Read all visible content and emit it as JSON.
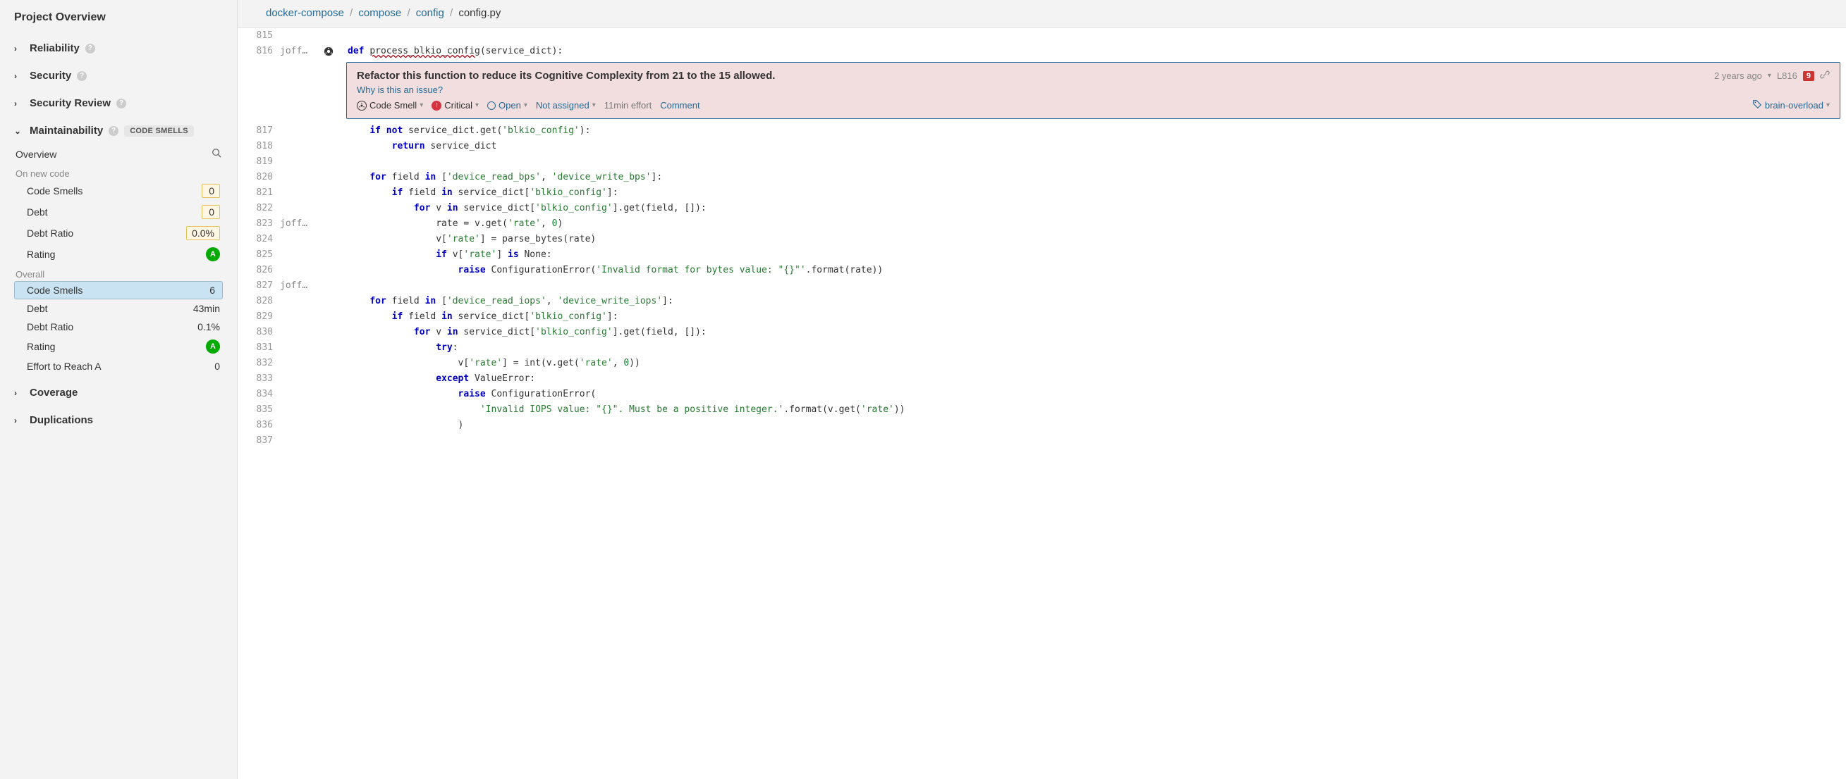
{
  "sidebar": {
    "title": "Project Overview",
    "sections": [
      {
        "label": "Reliability",
        "expanded": false,
        "help": true
      },
      {
        "label": "Security",
        "expanded": false,
        "help": true
      },
      {
        "label": "Security Review",
        "expanded": false,
        "help": true
      },
      {
        "label": "Maintainability",
        "expanded": true,
        "help": true,
        "badge": "CODE SMELLS"
      },
      {
        "label": "Coverage",
        "expanded": false
      },
      {
        "label": "Duplications",
        "expanded": false
      }
    ],
    "overview_label": "Overview",
    "new_code_label": "On new code",
    "overall_label": "Overall",
    "new_code": [
      {
        "label": "Code Smells",
        "value": "0",
        "boxed": true
      },
      {
        "label": "Debt",
        "value": "0",
        "boxed": true
      },
      {
        "label": "Debt Ratio",
        "value": "0.0%",
        "boxed": true
      },
      {
        "label": "Rating",
        "value": "A",
        "rating": true
      }
    ],
    "overall": [
      {
        "label": "Code Smells",
        "value": "6",
        "selected": true
      },
      {
        "label": "Debt",
        "value": "43min"
      },
      {
        "label": "Debt Ratio",
        "value": "0.1%"
      },
      {
        "label": "Rating",
        "value": "A",
        "rating": true
      },
      {
        "label": "Effort to Reach A",
        "value": "0"
      }
    ]
  },
  "breadcrumb": {
    "parts": [
      "docker-compose",
      "compose",
      "config"
    ],
    "current": "config.py"
  },
  "issue": {
    "title": "Refactor this function to reduce its Cognitive Complexity from 21 to the 15 allowed.",
    "age": "2 years ago",
    "line": "L816",
    "count": "9",
    "why": "Why is this an issue?",
    "type": "Code Smell",
    "severity": "Critical",
    "status": "Open",
    "assignee": "Not assigned",
    "effort": "11min effort",
    "comment": "Comment",
    "tag": "brain-overload"
  },
  "code": {
    "lines": [
      {
        "n": "815",
        "author": "",
        "bar": false,
        "text": ""
      },
      {
        "n": "816",
        "author": "joff…",
        "bar": true,
        "icon": true,
        "parts": [
          {
            "t": "def ",
            "c": "kw"
          },
          {
            "t": "process_blkio_config",
            "c": "fn-name underline-issue"
          },
          {
            "t": "(service_dict):"
          }
        ]
      },
      {
        "n": "817",
        "author": "",
        "bar": true,
        "parts": [
          {
            "t": "    "
          },
          {
            "t": "if not",
            "c": "kw"
          },
          {
            "t": " service_dict.get("
          },
          {
            "t": "'blkio_config'",
            "c": "str"
          },
          {
            "t": "):"
          }
        ]
      },
      {
        "n": "818",
        "author": "",
        "bar": true,
        "parts": [
          {
            "t": "        "
          },
          {
            "t": "return",
            "c": "kw"
          },
          {
            "t": " service_dict"
          }
        ]
      },
      {
        "n": "819",
        "author": "",
        "bar": false,
        "text": ""
      },
      {
        "n": "820",
        "author": "",
        "bar": true,
        "parts": [
          {
            "t": "    "
          },
          {
            "t": "for",
            "c": "kw"
          },
          {
            "t": " field "
          },
          {
            "t": "in",
            "c": "kw"
          },
          {
            "t": " ["
          },
          {
            "t": "'device_read_bps'",
            "c": "str"
          },
          {
            "t": ", "
          },
          {
            "t": "'device_write_bps'",
            "c": "str"
          },
          {
            "t": "]:"
          }
        ]
      },
      {
        "n": "821",
        "author": "",
        "bar": true,
        "parts": [
          {
            "t": "        "
          },
          {
            "t": "if",
            "c": "kw"
          },
          {
            "t": " field "
          },
          {
            "t": "in",
            "c": "kw"
          },
          {
            "t": " service_dict["
          },
          {
            "t": "'blkio_config'",
            "c": "str"
          },
          {
            "t": "]:"
          }
        ]
      },
      {
        "n": "822",
        "author": "",
        "bar": true,
        "parts": [
          {
            "t": "            "
          },
          {
            "t": "for",
            "c": "kw"
          },
          {
            "t": " v "
          },
          {
            "t": "in",
            "c": "kw"
          },
          {
            "t": " service_dict["
          },
          {
            "t": "'blkio_config'",
            "c": "str"
          },
          {
            "t": "].get(field, []):"
          }
        ]
      },
      {
        "n": "823",
        "author": "joff…",
        "bar": true,
        "parts": [
          {
            "t": "                rate = v.get("
          },
          {
            "t": "'rate'",
            "c": "str"
          },
          {
            "t": ", "
          },
          {
            "t": "0",
            "c": "num"
          },
          {
            "t": ")"
          }
        ]
      },
      {
        "n": "824",
        "author": "",
        "bar": true,
        "parts": [
          {
            "t": "                v["
          },
          {
            "t": "'rate'",
            "c": "str"
          },
          {
            "t": "] = parse_bytes(rate)"
          }
        ]
      },
      {
        "n": "825",
        "author": "",
        "bar": true,
        "parts": [
          {
            "t": "                "
          },
          {
            "t": "if",
            "c": "kw"
          },
          {
            "t": " v["
          },
          {
            "t": "'rate'",
            "c": "str"
          },
          {
            "t": "] "
          },
          {
            "t": "is",
            "c": "kw"
          },
          {
            "t": " None:"
          }
        ]
      },
      {
        "n": "826",
        "author": "",
        "bar": true,
        "parts": [
          {
            "t": "                    "
          },
          {
            "t": "raise",
            "c": "kw"
          },
          {
            "t": " ConfigurationError("
          },
          {
            "t": "'Invalid format for bytes value: \"{}\"'",
            "c": "str"
          },
          {
            "t": ".format(rate))"
          }
        ]
      },
      {
        "n": "827",
        "author": "joff…",
        "bar": false,
        "text": ""
      },
      {
        "n": "828",
        "author": "",
        "bar": true,
        "parts": [
          {
            "t": "    "
          },
          {
            "t": "for",
            "c": "kw"
          },
          {
            "t": " field "
          },
          {
            "t": "in",
            "c": "kw"
          },
          {
            "t": " ["
          },
          {
            "t": "'device_read_iops'",
            "c": "str"
          },
          {
            "t": ", "
          },
          {
            "t": "'device_write_iops'",
            "c": "str"
          },
          {
            "t": "]:"
          }
        ]
      },
      {
        "n": "829",
        "author": "",
        "bar": true,
        "parts": [
          {
            "t": "        "
          },
          {
            "t": "if",
            "c": "kw"
          },
          {
            "t": " field "
          },
          {
            "t": "in",
            "c": "kw"
          },
          {
            "t": " service_dict["
          },
          {
            "t": "'blkio_config'",
            "c": "str"
          },
          {
            "t": "]:"
          }
        ]
      },
      {
        "n": "830",
        "author": "",
        "bar": true,
        "parts": [
          {
            "t": "            "
          },
          {
            "t": "for",
            "c": "kw"
          },
          {
            "t": " v "
          },
          {
            "t": "in",
            "c": "kw"
          },
          {
            "t": " service_dict["
          },
          {
            "t": "'blkio_config'",
            "c": "str"
          },
          {
            "t": "].get(field, []):"
          }
        ]
      },
      {
        "n": "831",
        "author": "",
        "bar": true,
        "parts": [
          {
            "t": "                "
          },
          {
            "t": "try",
            "c": "kw"
          },
          {
            "t": ":"
          }
        ]
      },
      {
        "n": "832",
        "author": "",
        "bar": true,
        "parts": [
          {
            "t": "                    v["
          },
          {
            "t": "'rate'",
            "c": "str"
          },
          {
            "t": "] = int(v.get("
          },
          {
            "t": "'rate'",
            "c": "str"
          },
          {
            "t": ", "
          },
          {
            "t": "0",
            "c": "num"
          },
          {
            "t": "))"
          }
        ]
      },
      {
        "n": "833",
        "author": "",
        "bar": true,
        "parts": [
          {
            "t": "                "
          },
          {
            "t": "except",
            "c": "kw"
          },
          {
            "t": " ValueError:"
          }
        ]
      },
      {
        "n": "834",
        "author": "",
        "bar": true,
        "parts": [
          {
            "t": "                    "
          },
          {
            "t": "raise",
            "c": "kw"
          },
          {
            "t": " ConfigurationError("
          }
        ]
      },
      {
        "n": "835",
        "author": "",
        "bar": false,
        "parts": [
          {
            "t": "                        "
          },
          {
            "t": "'Invalid IOPS value: \"{}\". Must be a positive integer.'",
            "c": "str"
          },
          {
            "t": ".format(v.get("
          },
          {
            "t": "'rate'",
            "c": "str"
          },
          {
            "t": "))"
          }
        ]
      },
      {
        "n": "836",
        "author": "",
        "bar": false,
        "parts": [
          {
            "t": "                    )"
          }
        ]
      },
      {
        "n": "837",
        "author": "",
        "bar": false,
        "text": ""
      }
    ]
  }
}
